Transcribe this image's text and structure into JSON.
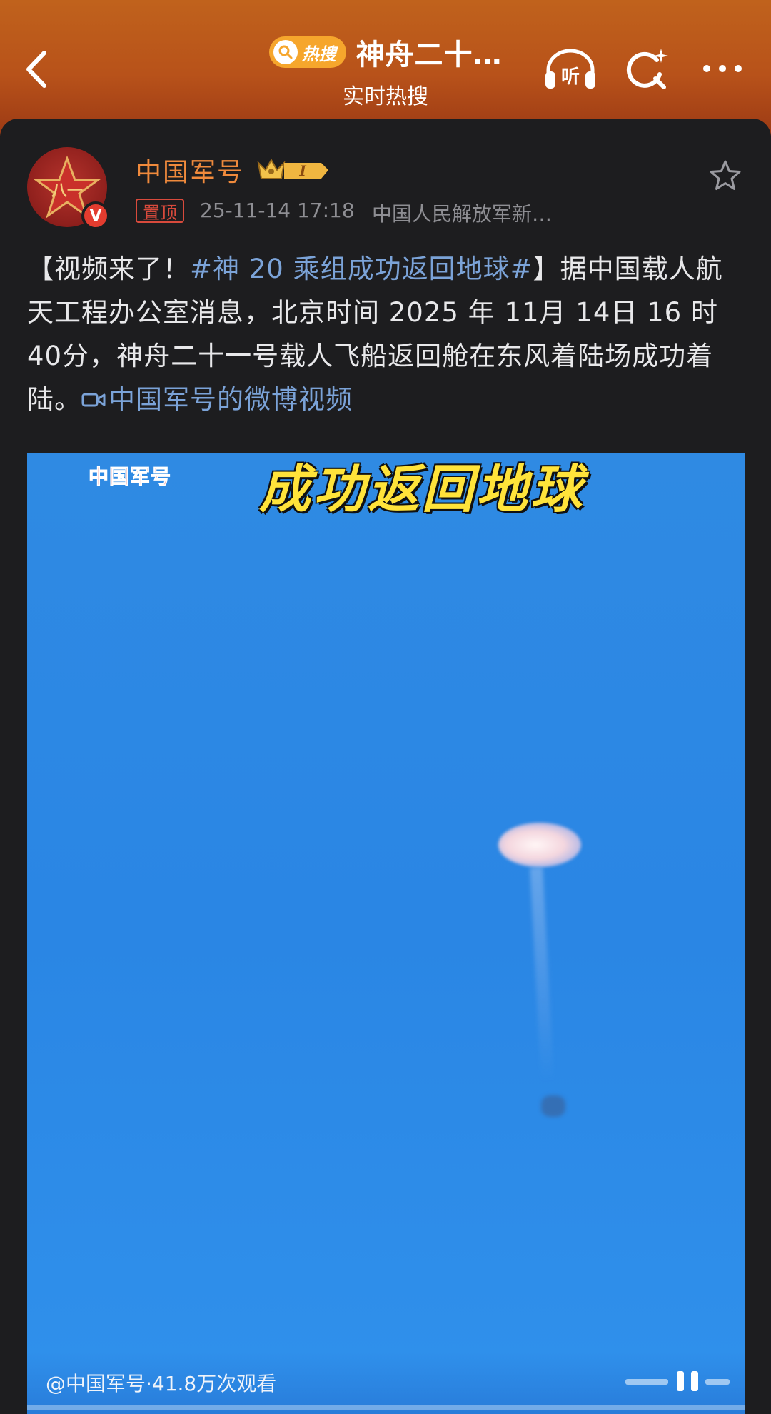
{
  "header": {
    "badge_label": "热搜",
    "title": "神舟二十…",
    "subtitle": "实时热搜"
  },
  "icons": {
    "back": "back-chevron-icon",
    "listen": "listen-headphones-icon",
    "search": "ai-search-icon",
    "more": "more-dots-icon",
    "favorite": "star-icon"
  },
  "post": {
    "username": "中国军号",
    "pinned_label": "置顶",
    "timestamp": "25-11-14 17:18",
    "source": "中国人民解放军新…",
    "text_prefix": "【视频来了！",
    "hashtag": "#神 20 乘组成功返回地球#",
    "text_body": "】据中国载人航天工程办公室消息，北京时间 2025 年 11月 14日 16 时 40分，神舟二十一号载人飞船返回舱在东风着陆场成功着陆。",
    "video_link": "中国军号的微博视频"
  },
  "video": {
    "watermark": "中国军号",
    "caption": "成功返回地球",
    "views": "@中国军号·41.8万次观看"
  },
  "colors": {
    "header_bg": "#b8521a",
    "username": "#f08a3c",
    "link": "#7ba3d8",
    "pin": "#d84a3c",
    "video_sky": "#2a86e4",
    "caption": "#ffe33a"
  }
}
